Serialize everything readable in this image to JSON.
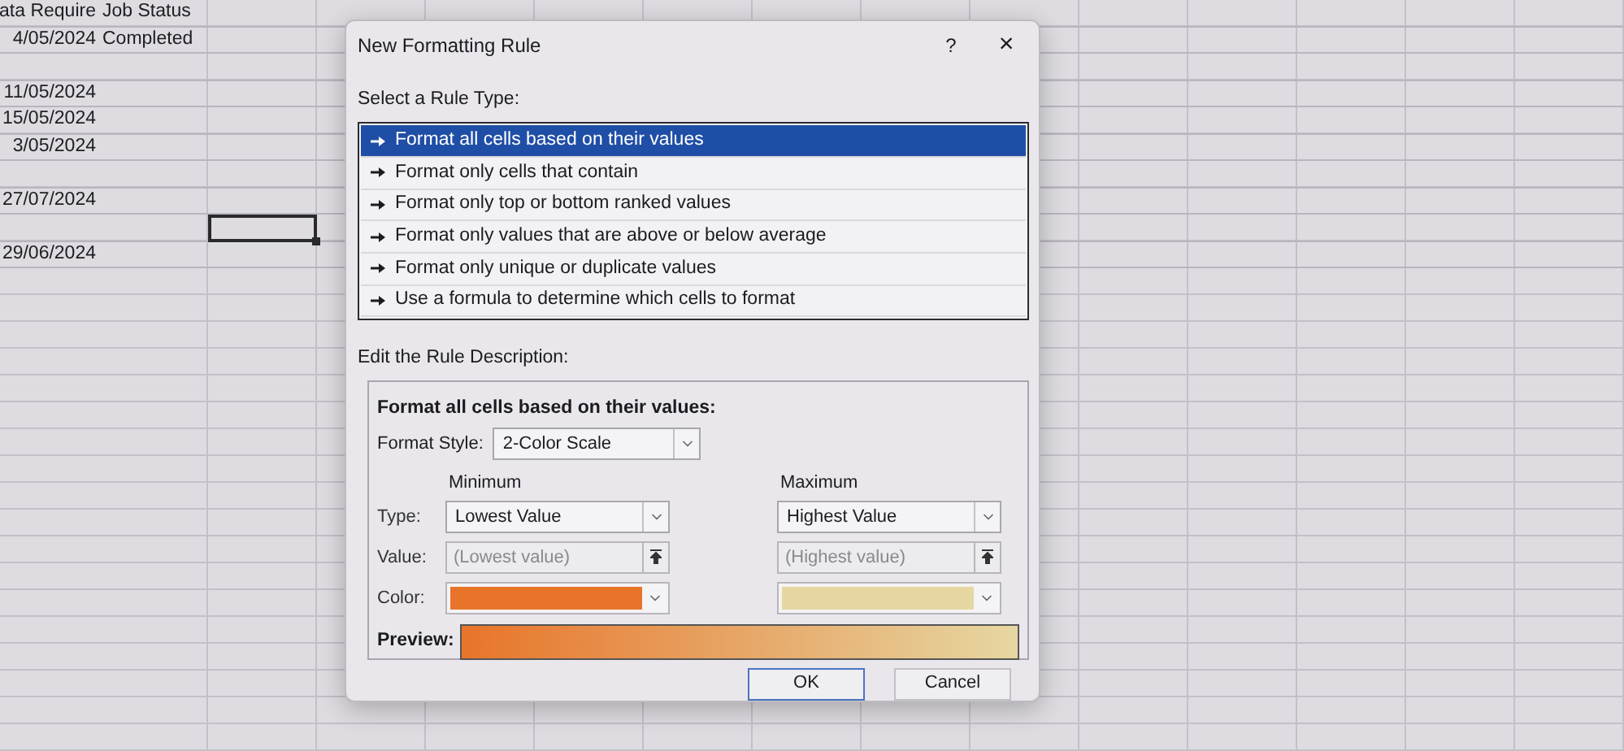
{
  "sheet": {
    "rows": [
      {
        "column_1": "ata Require",
        "column_2": "Job Status",
        "cell_3_selected": false
      },
      {
        "column_1": "4/05/2024",
        "column_2": "Completed",
        "cell_3_selected": false
      },
      {
        "cell_3_selected": false
      },
      {
        "column_1": "11/05/2024",
        "cell_3_selected": false
      },
      {
        "column_1": "15/05/2024",
        "cell_3_selected": false
      },
      {
        "column_1": "3/05/2024",
        "cell_3_selected": false
      },
      {
        "cell_3_selected": false
      },
      {
        "column_1": "27/07/2024",
        "cell_3_selected": false
      },
      {
        "cell_3_selected": true
      },
      {
        "column_1": "29/06/2024",
        "cell_3_selected": false
      }
    ]
  },
  "dialog": {
    "title": "New Formatting Rule",
    "help_button": "?",
    "close_button": "×",
    "rule_type_label": "Select a Rule Type:",
    "rule_types": [
      {
        "label": "Format all cells based on their values",
        "selected": true
      },
      {
        "label": "Format only cells that contain",
        "selected": false
      },
      {
        "label": "Format only top or bottom ranked values",
        "selected": false
      },
      {
        "label": "Format only values that are above or below average",
        "selected": false
      },
      {
        "label": "Format only unique or duplicate values",
        "selected": false
      },
      {
        "label": "Use a formula to determine which cells to format",
        "selected": false
      }
    ],
    "description_label": "Edit the Rule Description:",
    "description": {
      "heading": "Format all cells based on their values:",
      "format_style_label": "Format Style:",
      "format_style": "2-Color Scale",
      "row_labels": [
        "Type:",
        "Value:",
        "Color:"
      ],
      "minimum": {
        "heading": "Minimum",
        "type": "Lowest Value",
        "value": {
          "placeholder": "(Lowest value)"
        },
        "color": "#e8742a"
      },
      "maximum": {
        "heading": "Maximum",
        "type": "Highest Value",
        "value": {
          "placeholder": "(Highest value)"
        },
        "color": "#e6d7a2"
      },
      "preview_label": "Preview:"
    },
    "buttons": [
      "OK",
      "Cancel"
    ]
  }
}
